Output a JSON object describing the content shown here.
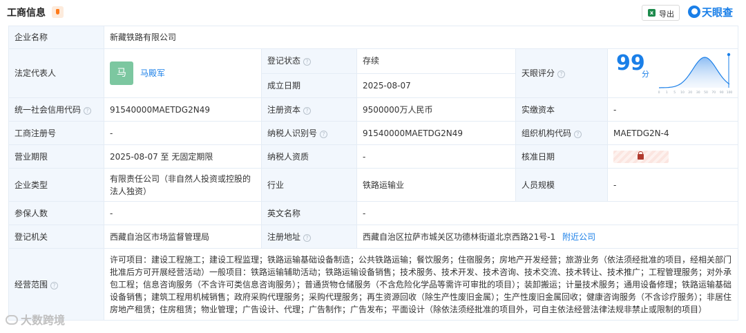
{
  "header": {
    "title": "工商信息",
    "export_label": "导出",
    "brand": "天眼查"
  },
  "rows": {
    "company_name_label": "企业名称",
    "company_name": "新藏铁路有限公司",
    "legal_rep_label": "法定代表人",
    "legal_rep_avatar": "马",
    "legal_rep_name": "马殿军",
    "reg_status_label": "登记状态",
    "reg_status": "存续",
    "found_date_label": "成立日期",
    "found_date": "2025-08-07",
    "score_label": "天眼评分",
    "score_value": "99",
    "score_unit": "分",
    "credit_code_label": "统一社会信用代码",
    "credit_code": "91540000MAETDG2N49",
    "reg_capital_label": "注册资本",
    "reg_capital": "9500000万人民币",
    "paid_capital_label": "实缴资本",
    "paid_capital": "-",
    "biz_reg_no_label": "工商注册号",
    "biz_reg_no": "-",
    "taxpayer_id_label": "纳税人识别号",
    "taxpayer_id": "91540000MAETDG2N49",
    "org_code_label": "组织机构代码",
    "org_code": "MAETDG2N-4",
    "biz_term_label": "营业期限",
    "biz_term": "2025-08-07 至 无固定期限",
    "taxpayer_qual_label": "纳税人资质",
    "taxpayer_qual": "-",
    "approval_date_label": "核准日期",
    "company_type_label": "企业类型",
    "company_type": "有限责任公司（非自然人投资或控股的法人独资）",
    "industry_label": "行业",
    "industry": "铁路运输业",
    "staff_size_label": "人员规模",
    "staff_size": "-",
    "insured_label": "参保人数",
    "insured": "-",
    "english_name_label": "英文名称",
    "english_name": "-",
    "reg_authority_label": "登记机关",
    "reg_authority": "西藏自治区市场监督管理局",
    "reg_address_label": "注册地址",
    "reg_address": "西藏自治区拉萨市城关区功德林街道北京西路21号-1",
    "nearby_link": "附近公司",
    "scope_label": "经营范围",
    "scope": "许可项目：建设工程施工；建设工程监理；铁路运输基础设备制造；公共铁路运输；餐饮服务；住宿服务；房地产开发经营；旅游业务（依法须经批准的项目，经相关部门批准后方可开展经营活动）一般项目：铁路运输辅助活动；铁路运输设备销售；技术服务、技术开发、技术咨询、技术交流、技术转让、技术推广；工程管理服务；对外承包工程；信息咨询服务（不含许可类信息咨询服务）；普通货物仓储服务（不含危险化学品等需许可审批的项目）；装卸搬运；计量技术服务；通用设备修理；铁路运输基础设备销售；建筑工程用机械销售；政府采购代理服务；采购代理服务；再生资源回收（除生产性废旧金属）；生产性废旧金属回收；健康咨询服务（不含诊疗服务）；非居住房地产租赁；住房租赁；物业管理；广告设计、代理；广告制作；广告发布；平面设计（除依法须经批准的项目外，可自主依法经营法律法规非禁止或限制的项目）"
  },
  "score_axis_ticks": [
    "0",
    "1",
    "5",
    "10",
    "20",
    "30",
    "50",
    "70",
    "90",
    "100"
  ],
  "watermark": "大数跨境",
  "colors": {
    "accent": "#1a7fe8",
    "status_green": "#22a95a",
    "label_bg": "#f2f7fd",
    "border": "#e4ecf5"
  }
}
